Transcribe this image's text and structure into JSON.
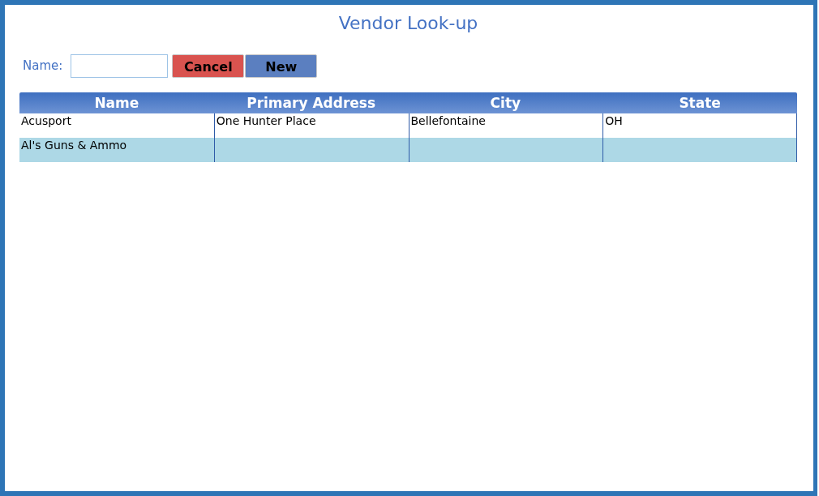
{
  "title": "Vendor Look-up",
  "search": {
    "label": "Name:"
  },
  "buttons": [
    {
      "label": "Cancel",
      "kind": "cancel"
    },
    {
      "label": "New",
      "kind": "new"
    }
  ],
  "table": {
    "columns": [
      "Name",
      "Primary Address",
      "City",
      "State"
    ],
    "rows": [
      [
        "Acusport",
        "One Hunter Place",
        "Bellefontaine",
        "OH"
      ],
      [
        "Al's Guns & Ammo",
        null,
        null,
        null
      ]
    ]
  }
}
